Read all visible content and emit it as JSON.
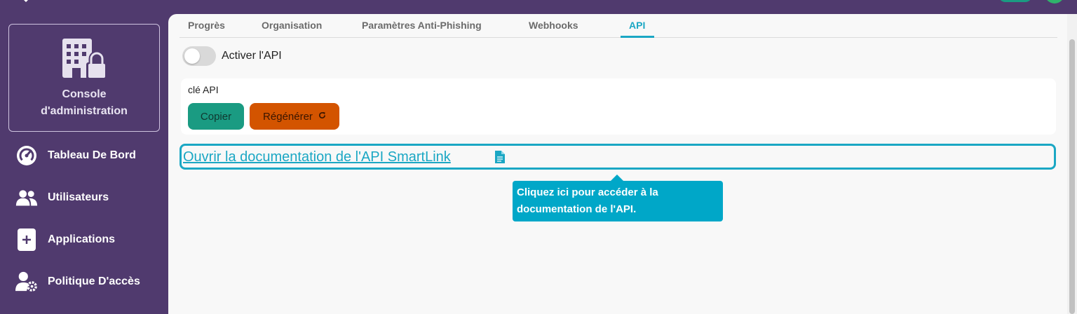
{
  "colors": {
    "sidebar_bg": "#503a6e",
    "accent": "#1ba7c4",
    "copy_button": "#1a9b82",
    "regenerate_button": "#d35400",
    "tooltip_bg": "#00a7c8"
  },
  "sidebar": {
    "console": {
      "icon": "building-lock-icon",
      "label_line1": "Console",
      "label_line2": "d'administration"
    },
    "items": [
      {
        "icon": "speedometer-icon",
        "label": "Tableau De Bord"
      },
      {
        "icon": "users-icon",
        "label": "Utilisateurs"
      },
      {
        "icon": "plus-square-icon",
        "label": "Applications"
      },
      {
        "icon": "user-gear-icon",
        "label": "Politique D'accès"
      }
    ]
  },
  "tabs": [
    {
      "label": "Progrès",
      "active": false
    },
    {
      "label": "Organisation",
      "active": false
    },
    {
      "label": "Paramètres Anti-Phishing",
      "active": false
    },
    {
      "label": "Webhooks",
      "active": false
    },
    {
      "label": "API",
      "active": true
    }
  ],
  "api": {
    "toggle_label": "Activer l'API",
    "toggle_on": false,
    "key_label": "clé API",
    "copy_label": "Copier",
    "regenerate_label": "Régénérer",
    "doc_link": "Ouvrir la documentation de l'API SmartLink",
    "doc_icon": "document-icon"
  },
  "tooltip": {
    "line1": "Cliquez ici pour accéder à la",
    "line2": "documentation de l'API."
  }
}
